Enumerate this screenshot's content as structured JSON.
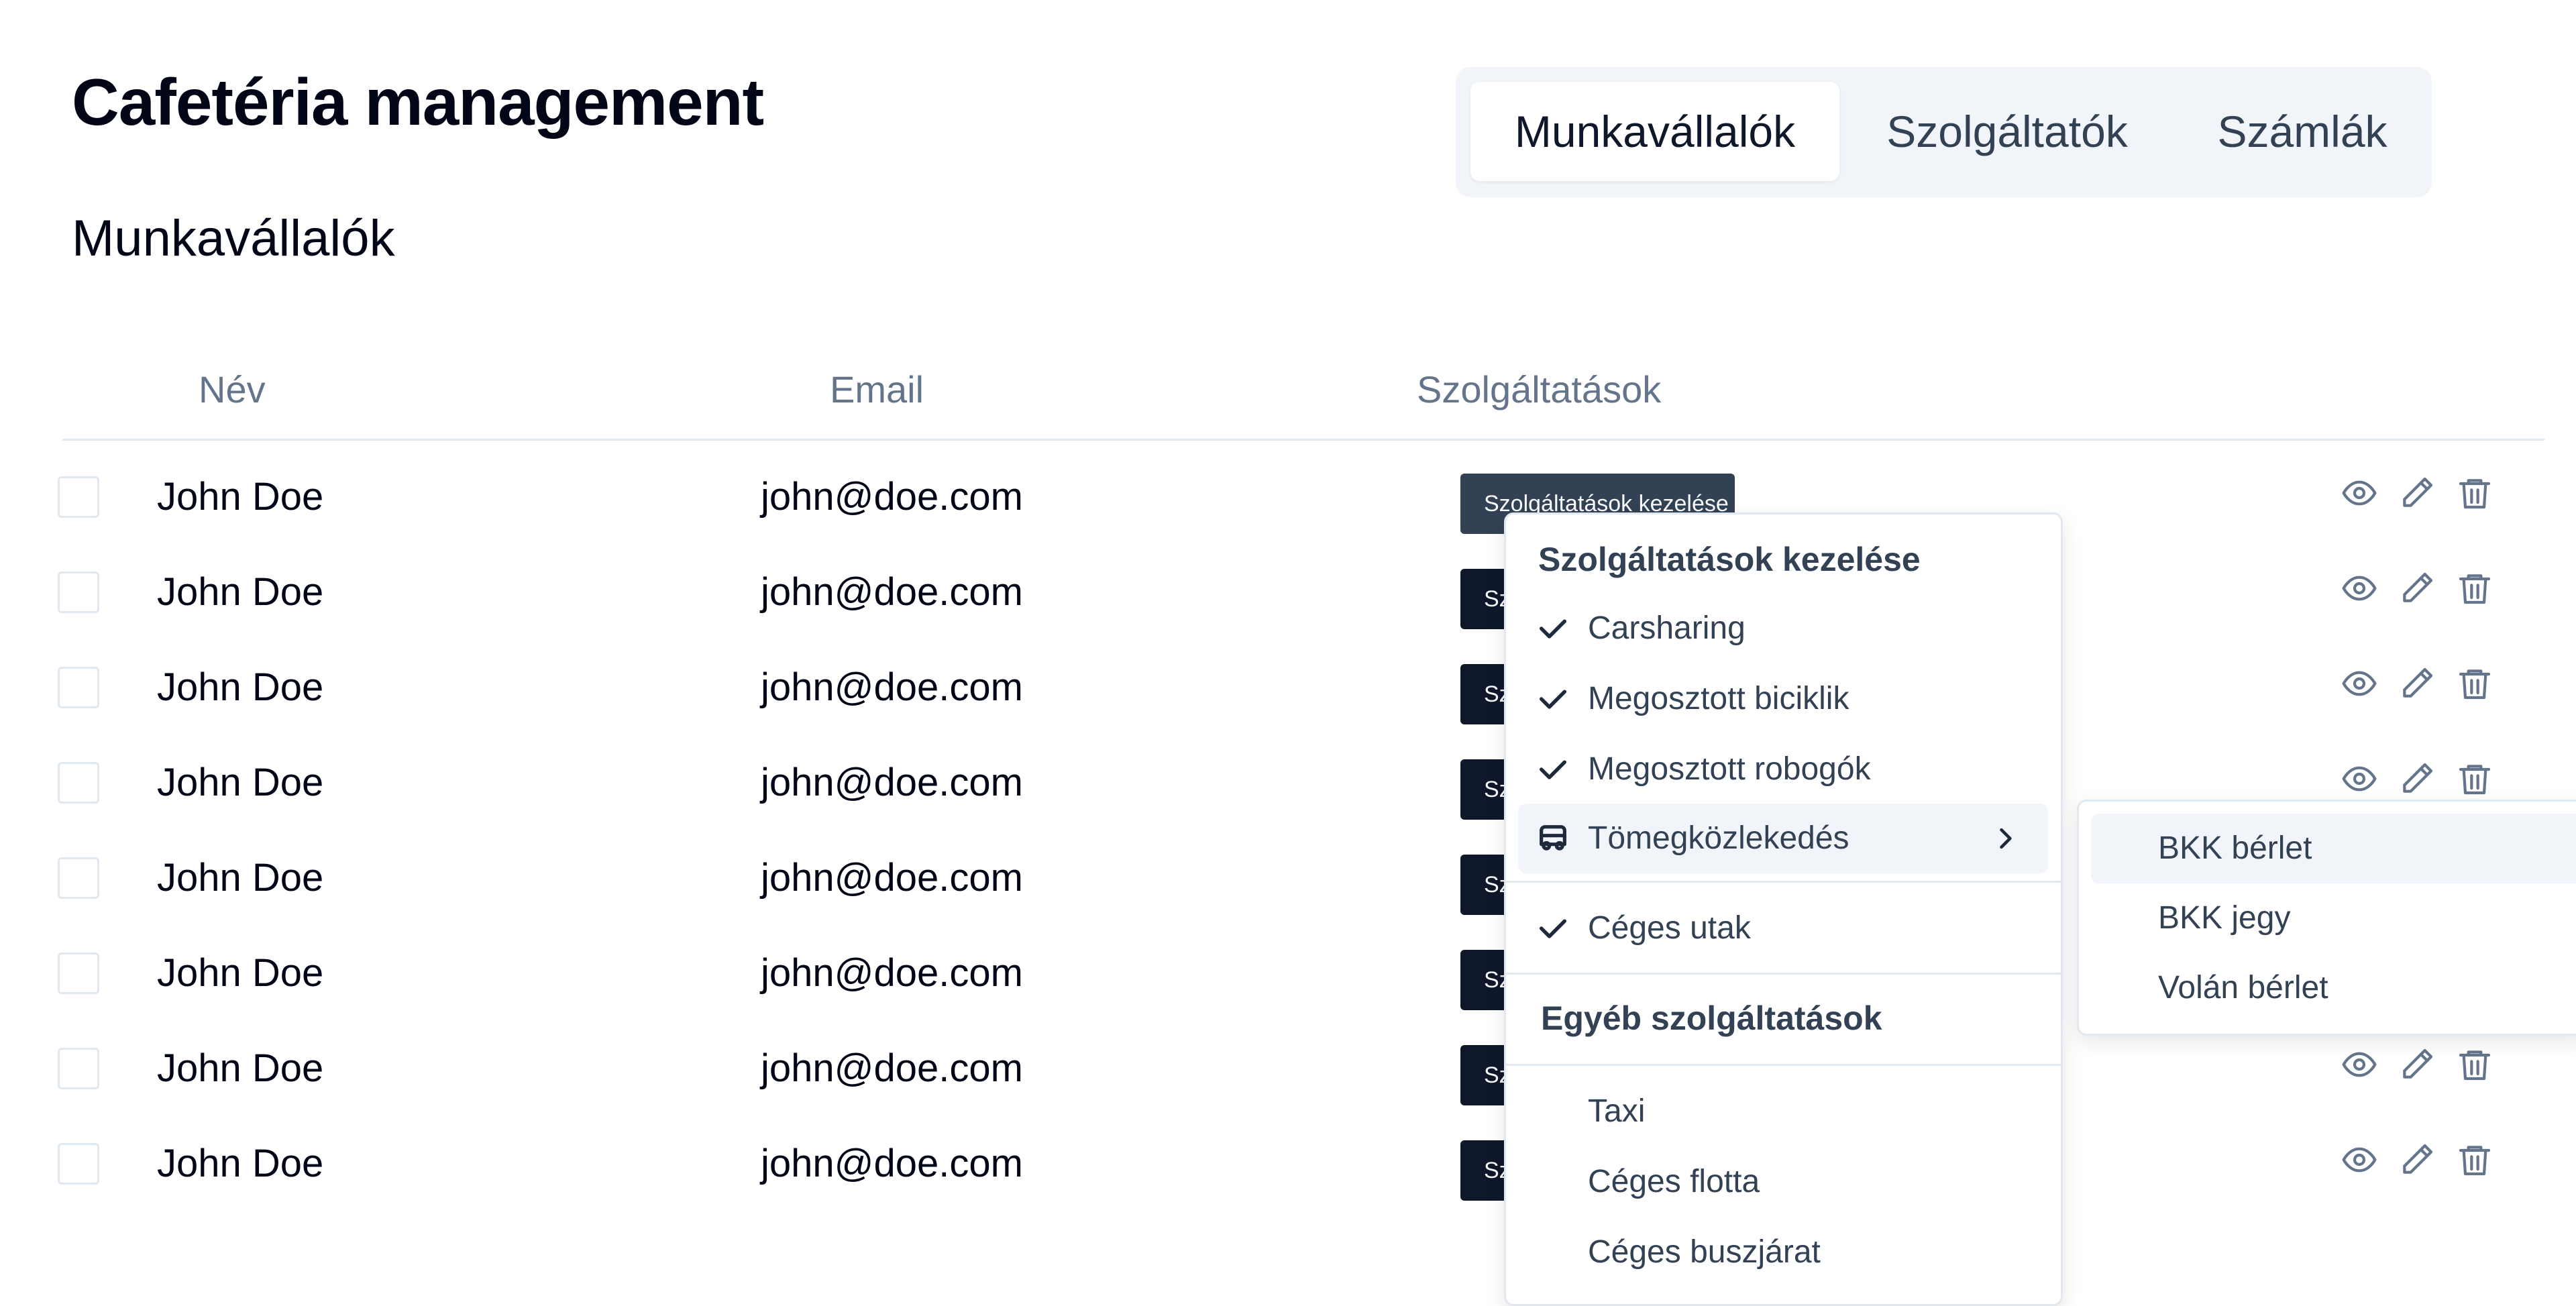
{
  "app": {
    "title": "Cafetéria management"
  },
  "tabs": [
    {
      "label": "Munkavállalók",
      "active": true
    },
    {
      "label": "Szolgáltatók",
      "active": false
    },
    {
      "label": "Számlák",
      "active": false
    }
  ],
  "section": {
    "title": "Munkavállalók"
  },
  "table": {
    "columns": [
      "Név",
      "Email",
      "Szolgáltatások"
    ],
    "rows": [
      {
        "name": "John Doe",
        "email": "john@doe.com",
        "services_button": "Szolgáltatások kezelése",
        "checked": false
      },
      {
        "name": "John Doe",
        "email": "john@doe.com",
        "services_button": "Szolgáltatások kezelése",
        "checked": false
      },
      {
        "name": "John Doe",
        "email": "john@doe.com",
        "services_button": "Szolgáltatások kezelése",
        "checked": false
      },
      {
        "name": "John Doe",
        "email": "john@doe.com",
        "services_button": "Szolgáltatások kezelése",
        "checked": false
      },
      {
        "name": "John Doe",
        "email": "john@doe.com",
        "services_button": "Szolgáltatások kezelése",
        "checked": false
      },
      {
        "name": "John Doe",
        "email": "john@doe.com",
        "services_button": "Szolgáltatások kezelése",
        "checked": false
      },
      {
        "name": "John Doe",
        "email": "john@doe.com",
        "services_button": "Szolgáltatások kezelése",
        "checked": false
      },
      {
        "name": "John Doe",
        "email": "john@doe.com",
        "services_button": "Szolgáltatások kezelése",
        "checked": false
      }
    ],
    "row_actions": [
      "eye-icon",
      "pencil-icon",
      "trash-icon"
    ]
  },
  "menu": {
    "label": "Szolgáltatások kezelése",
    "items": [
      {
        "label": "Carsharing",
        "checked": true
      },
      {
        "label": "Megosztott biciklik",
        "checked": true
      },
      {
        "label": "Megosztott robogók",
        "checked": true
      },
      {
        "label": "Tömegközlekedés",
        "icon": "bus-icon",
        "submenu": true,
        "highlighted": true
      },
      {
        "label": "Céges utak",
        "checked": true
      }
    ],
    "other_label": "Egyéb szolgáltatások",
    "other_items": [
      {
        "label": "Taxi",
        "checked": false
      },
      {
        "label": "Céges flotta",
        "checked": false
      },
      {
        "label": "Céges buszjárat",
        "checked": false
      }
    ]
  },
  "submenu": {
    "items": [
      {
        "label": "BKK bérlet",
        "highlighted": true
      },
      {
        "label": "BKK jegy",
        "highlighted": false
      },
      {
        "label": "Volán bérlet",
        "highlighted": false
      }
    ]
  },
  "colors": {
    "button_dark": "#0f172a",
    "button_open": "#334155",
    "tab_bg": "#f1f5f9",
    "muted_text": "#64748b",
    "border": "#e2e8f0"
  }
}
